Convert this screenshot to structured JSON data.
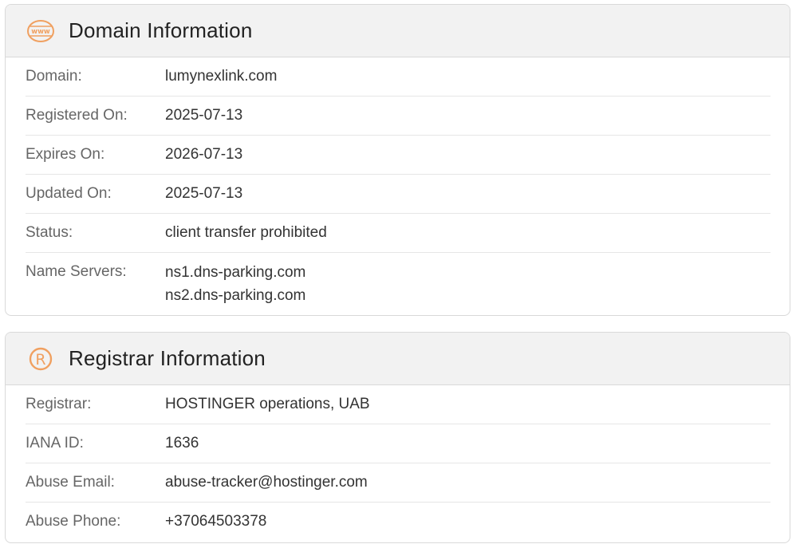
{
  "accent_color": "#f0a060",
  "domain_section": {
    "title": "Domain Information",
    "icon": "www-globe-icon",
    "rows": [
      {
        "label": "Domain:",
        "value": "lumynexlink.com"
      },
      {
        "label": "Registered On:",
        "value": "2025-07-13"
      },
      {
        "label": "Expires On:",
        "value": "2026-07-13"
      },
      {
        "label": "Updated On:",
        "value": "2025-07-13"
      },
      {
        "label": "Status:",
        "value": "client transfer prohibited"
      }
    ],
    "name_servers": {
      "label": "Name Servers:",
      "values": [
        "ns1.dns-parking.com",
        "ns2.dns-parking.com"
      ]
    }
  },
  "registrar_section": {
    "title": "Registrar Information",
    "icon": "registered-icon",
    "rows": [
      {
        "label": "Registrar:",
        "value": "HOSTINGER operations, UAB"
      },
      {
        "label": "IANA ID:",
        "value": "1636"
      },
      {
        "label": "Abuse Email:",
        "value": "abuse-tracker@hostinger.com"
      },
      {
        "label": "Abuse Phone:",
        "value": "+37064503378"
      }
    ]
  }
}
